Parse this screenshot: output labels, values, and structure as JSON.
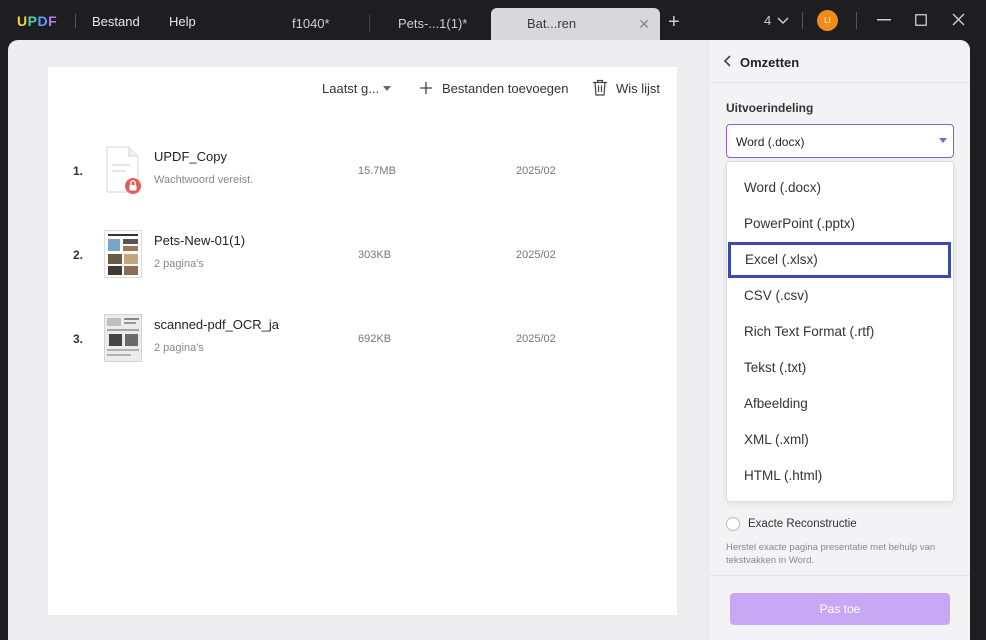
{
  "app": {
    "logo_text": "UPDF",
    "menu": [
      "Bestand",
      "Help"
    ]
  },
  "tabs": [
    {
      "label": "f1040*"
    },
    {
      "label": "Pets-...1(1)*"
    },
    {
      "label": "Bat...ren"
    }
  ],
  "titlebar": {
    "window_count": "4",
    "avatar_initials": "LI"
  },
  "filelist": {
    "sort_label": "Laatst g...",
    "add_files_label": "Bestanden toevoegen",
    "clear_list_label": "Wis lijst",
    "files": [
      {
        "index": "1.",
        "name": "UPDF_Copy",
        "sub": "Wachtwoord vereist.",
        "size": "15.7MB",
        "date": "2025/02",
        "locked": true
      },
      {
        "index": "2.",
        "name": "Pets-New-01(1)",
        "sub": "2 pagina's",
        "size": "303KB",
        "date": "2025/02",
        "locked": false
      },
      {
        "index": "3.",
        "name": "scanned-pdf_OCR_ja",
        "sub": "2 pagina's",
        "size": "692KB",
        "date": "2025/02",
        "locked": false
      }
    ]
  },
  "panel": {
    "title": "Omzetten",
    "format_label": "Uitvoerindeling",
    "selected_format": "Word (.docx)",
    "options": [
      "Word (.docx)",
      "PowerPoint (.pptx)",
      "Excel (.xlsx)",
      "CSV (.csv)",
      "Rich Text Format (.rtf)",
      "Tekst (.txt)",
      "Afbeelding",
      "XML (.xml)",
      "HTML (.html)"
    ],
    "highlighted_option": "Excel (.xlsx)",
    "exact_label": "Exacte Reconstructie",
    "exact_hint": "Herstel exacte pagina presentatie met behulp van tekstvakken in Word.",
    "apply_label": "Pas toe"
  },
  "colors": {
    "accent": "#8a5ed8",
    "apply_button": "#c8a8f5",
    "highlight_border": "#3d48b4",
    "avatar": "#f08c1a"
  }
}
